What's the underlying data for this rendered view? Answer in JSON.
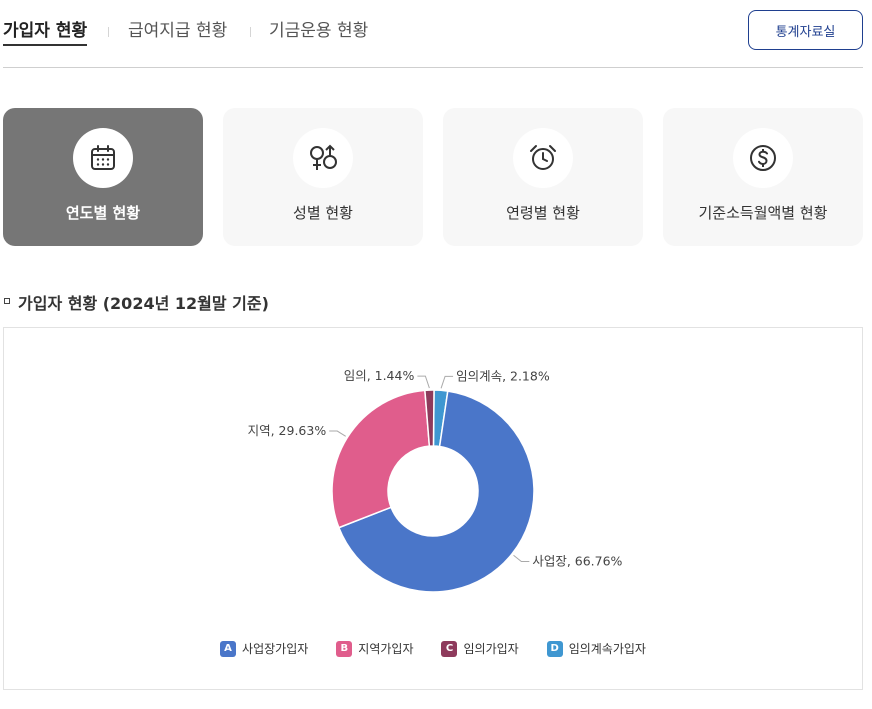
{
  "tabs": [
    {
      "label": "가입자 현황",
      "active": true
    },
    {
      "label": "급여지급 현황",
      "active": false
    },
    {
      "label": "기금운용 현황",
      "active": false
    }
  ],
  "stats_button": {
    "label": "통계자료실"
  },
  "cards": [
    {
      "label": "연도별 현황",
      "icon": "calendar-icon",
      "active": true
    },
    {
      "label": "성별 현황",
      "icon": "gender-icon",
      "active": false
    },
    {
      "label": "연령별 현황",
      "icon": "alarm-clock-icon",
      "active": false
    },
    {
      "label": "기준소득월액별 현황",
      "icon": "dollar-icon",
      "active": false
    }
  ],
  "section": {
    "title": "가입자 현황 (2024년 12월말 기준)"
  },
  "chart_data": {
    "type": "pie",
    "donut": true,
    "slices": [
      {
        "label": "사업장",
        "value": 66.76,
        "legend": "사업장가입자",
        "marker": "A",
        "color": "#4a76c9"
      },
      {
        "label": "지역",
        "value": 29.63,
        "legend": "지역가입자",
        "marker": "B",
        "color": "#e05d8c"
      },
      {
        "label": "임의",
        "value": 1.44,
        "legend": "임의가입자",
        "marker": "C",
        "color": "#8e3a5c"
      },
      {
        "label": "임의계속",
        "value": 2.18,
        "legend": "임의계속가입자",
        "marker": "D",
        "color": "#3f97d1"
      }
    ],
    "legend_position": "bottom-center"
  }
}
